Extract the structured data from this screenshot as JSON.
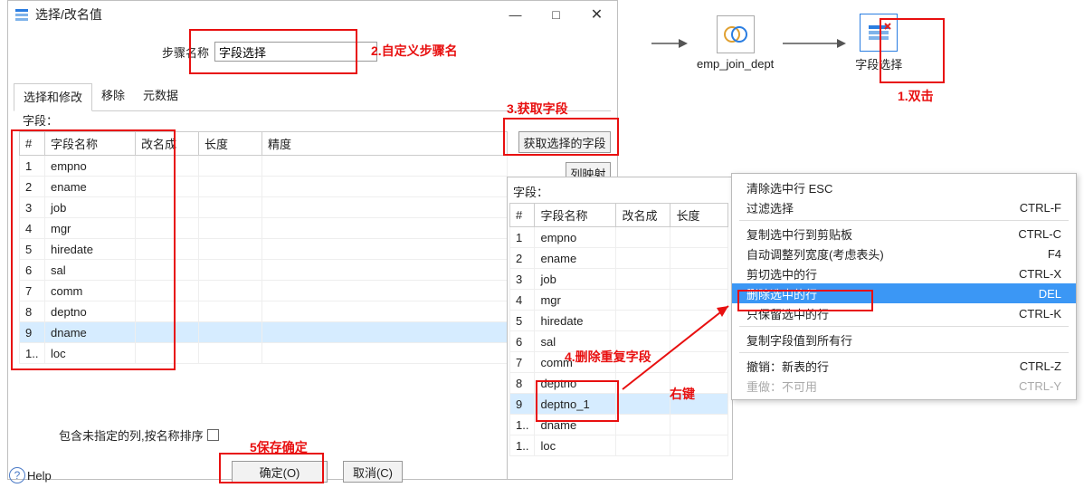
{
  "dialog": {
    "title": "选择/改名值",
    "step_label": "步骤名称",
    "step_value": "字段选择",
    "tabs": {
      "t1": "选择和修改",
      "t2": "移除",
      "t3": "元数据"
    },
    "fields_label": "字段：",
    "headers": {
      "num": "#",
      "name": "字段名称",
      "rename": "改名成",
      "len": "长度",
      "prec": "精度"
    },
    "rows": [
      {
        "n": "1",
        "name": "empno"
      },
      {
        "n": "2",
        "name": "ename"
      },
      {
        "n": "3",
        "name": "job"
      },
      {
        "n": "4",
        "name": "mgr"
      },
      {
        "n": "5",
        "name": "hiredate"
      },
      {
        "n": "6",
        "name": "sal"
      },
      {
        "n": "7",
        "name": "comm"
      },
      {
        "n": "8",
        "name": "deptno"
      },
      {
        "n": "9",
        "name": "dname"
      },
      {
        "n": "1..",
        "name": "loc"
      }
    ],
    "btn_getfields": "获取选择的字段",
    "btn_colmap": "列映射",
    "include_label": "包含未指定的列,按名称排序",
    "help": "Help",
    "ok": "确定(O)",
    "cancel": "取消(C)"
  },
  "panel2": {
    "fields_label": "字段：",
    "headers": {
      "num": "#",
      "name": "字段名称",
      "rename": "改名成",
      "len": "长度"
    },
    "rows": [
      {
        "n": "1",
        "name": "empno"
      },
      {
        "n": "2",
        "name": "ename"
      },
      {
        "n": "3",
        "name": "job"
      },
      {
        "n": "4",
        "name": "mgr"
      },
      {
        "n": "5",
        "name": "hiredate"
      },
      {
        "n": "6",
        "name": "sal"
      },
      {
        "n": "7",
        "name": "comm"
      },
      {
        "n": "8",
        "name": "deptno"
      },
      {
        "n": "9",
        "name": "deptno_1"
      },
      {
        "n": "1..",
        "name": "dname"
      },
      {
        "n": "1..",
        "name": "loc"
      }
    ]
  },
  "ctx": {
    "i1": {
      "l": "清除选中行 ESC",
      "s": ""
    },
    "i2": {
      "l": "过滤选择",
      "s": "CTRL-F"
    },
    "i3": {
      "l": "复制选中行到剪贴板",
      "s": "CTRL-C"
    },
    "i4": {
      "l": "自动调整列宽度(考虑表头)",
      "s": "F4"
    },
    "i5": {
      "l": "剪切选中的行",
      "s": "CTRL-X"
    },
    "i6": {
      "l": "删除选中的行",
      "s": "DEL"
    },
    "i7": {
      "l": "只保留选中的行",
      "s": "CTRL-K"
    },
    "i8": {
      "l": "复制字段值到所有行",
      "s": ""
    },
    "i9": {
      "l": "撤销：新表的行",
      "s": "CTRL-Z"
    },
    "i10": {
      "l": "重做：不可用",
      "s": "CTRL-Y"
    }
  },
  "flow": {
    "node1": "emp_join_dept",
    "node2": "字段选择"
  },
  "callouts": {
    "c1": "1.双击",
    "c2": "2.自定义步骤名",
    "c3": "3.获取字段",
    "c4": "4.删除重复字段",
    "c4b": "右键",
    "c5": "5保存确定"
  }
}
